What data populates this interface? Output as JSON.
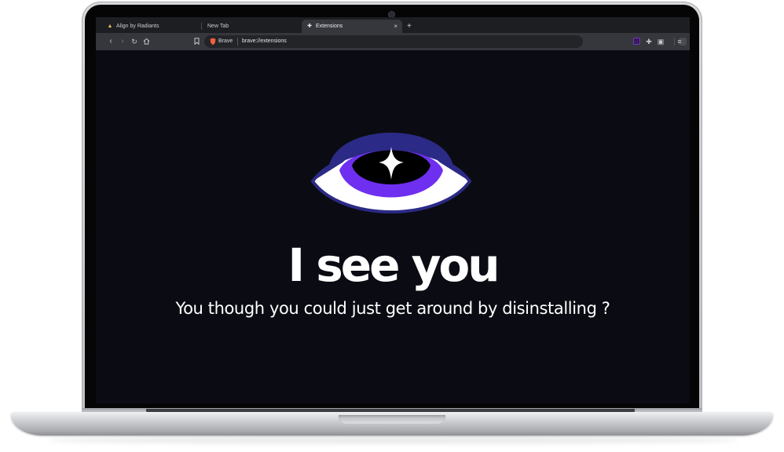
{
  "browser": {
    "tabs": [
      {
        "label": "Align by Radiants",
        "icon": "triangle-logo-icon",
        "active": false
      },
      {
        "label": "New Tab",
        "icon": "",
        "active": false
      },
      {
        "label": "Extensions",
        "icon": "puzzle-icon",
        "active": true
      }
    ],
    "new_tab_symbol": "+",
    "close_symbol": "×",
    "address": {
      "brand": "Brave",
      "url": "brave://extensions"
    }
  },
  "page": {
    "headline": "I see you",
    "subtext": "You though you could just get around by disinstalling ?",
    "colors": {
      "background": "#0b0c13",
      "eye_outer": "#2b2a86",
      "iris": "#6f2ff0",
      "text": "#ffffff"
    }
  }
}
